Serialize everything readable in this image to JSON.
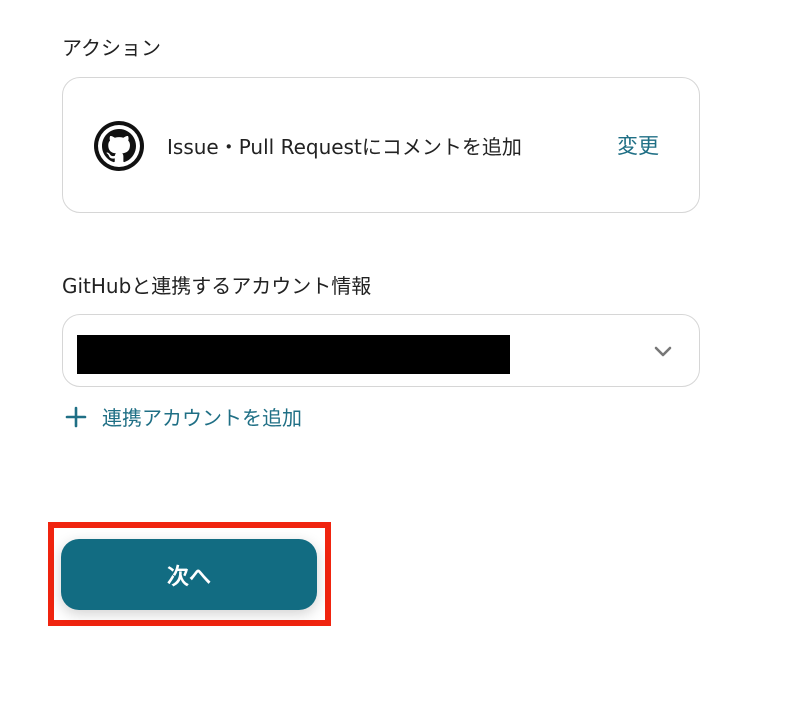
{
  "action_section": {
    "label": "アクション",
    "card": {
      "icon": "github-icon",
      "title": "Issue・Pull Requestにコメントを追加",
      "change_label": "変更"
    }
  },
  "account_section": {
    "label": "GitHubと連携するアカウント情報",
    "select": {
      "chevron_icon": "chevron-down-icon"
    },
    "add_link": {
      "icon": "plus-icon",
      "label": "連携アカウントを追加"
    }
  },
  "footer": {
    "next_label": "次へ"
  },
  "colors": {
    "accent": "#1f6f85",
    "button": "#126c82",
    "highlight": "#f0240f"
  }
}
